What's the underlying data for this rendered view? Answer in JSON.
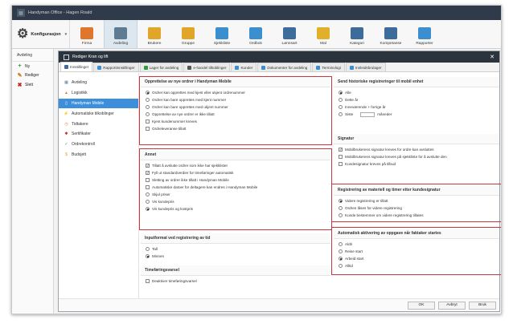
{
  "window": {
    "title": "Handyman Office - Hagen Roald"
  },
  "ribbon": {
    "section_label": "Konfigurasjon",
    "buttons": [
      {
        "label": "Firma",
        "color": "#e0752c",
        "icon": "home-icon"
      },
      {
        "label": "Avdeling",
        "color": "#5f7a93",
        "icon": "building-icon"
      },
      {
        "label": "Brukere",
        "color": "#e1a52a",
        "icon": "user-icon"
      },
      {
        "label": "Gruppe",
        "color": "#e1a52a",
        "icon": "group-icon"
      },
      {
        "label": "Sjekkliste",
        "color": "#3c8fcf",
        "icon": "checklist-icon"
      },
      {
        "label": "Ordbok",
        "color": "#3c8fcf",
        "icon": "book-icon"
      },
      {
        "label": "Lønnsart",
        "color": "#3d6b9a",
        "icon": "clock-icon"
      },
      {
        "label": "Mal",
        "color": "#e1b02a",
        "icon": "template-icon"
      },
      {
        "label": "Kategori",
        "color": "#3d6b9a",
        "icon": "category-icon"
      },
      {
        "label": "Kompetanse",
        "color": "#3d6b9a",
        "icon": "competence-icon"
      },
      {
        "label": "Rapporter",
        "color": "#3c8fcf",
        "icon": "report-icon"
      }
    ]
  },
  "leftpanel": {
    "header": "Avdeling",
    "items": [
      {
        "label": "Ny",
        "glyph": "+",
        "color": "#2e9c3a"
      },
      {
        "label": "Rediger",
        "glyph": "✎",
        "color": "#c8780c"
      },
      {
        "label": "Slett",
        "glyph": "✖",
        "color": "#cc2020"
      }
    ]
  },
  "dialog": {
    "title": "Rediger Kran og lift",
    "tabs": [
      {
        "label": "Innstillinger",
        "color": "#3d6b9a"
      },
      {
        "label": "Rapportinnstillinger",
        "color": "#3c8fcf"
      },
      {
        "label": "Lager for avdeling",
        "color": "#2e9c3a"
      },
      {
        "label": "e-handel tilkoblinger",
        "color": "#555555"
      },
      {
        "label": "Kunder",
        "color": "#3c8fcf"
      },
      {
        "label": "Dokumenter for avdeling",
        "color": "#3c8fcf"
      },
      {
        "label": "Terminologi",
        "color": "#3c8fcf"
      },
      {
        "label": "Innleidsbrulager",
        "color": "#3c8fcf"
      }
    ],
    "nav": [
      {
        "label": "Avdeling",
        "color": "#5f7a93",
        "glyph": "▦"
      },
      {
        "label": "Logistikk",
        "color": "#e0752c",
        "glyph": "▲"
      },
      {
        "label": "Handyman Mobile",
        "color": "#ffffff",
        "glyph": "▯"
      },
      {
        "label": "Automatiske tilkoblinger",
        "color": "#3c8fcf",
        "glyph": "⚡"
      },
      {
        "label": "Tidtakere",
        "color": "#e0752c",
        "glyph": "◷"
      },
      {
        "label": "Sertifikater",
        "color": "#cc2020",
        "glyph": "✱"
      },
      {
        "label": "Ordrekontroll",
        "color": "#2e9c3a",
        "glyph": "✓"
      },
      {
        "label": "Budsjett",
        "color": "#e1a52a",
        "glyph": "$"
      }
    ],
    "sections": {
      "opprettelse": {
        "header": "Opprettelse av nye ordrer i Handyman Mobile",
        "options": [
          {
            "type": "radio",
            "checked": true,
            "label": "Ordrer kan opprettes med kjent eller ukjent ordrenummer"
          },
          {
            "type": "radio",
            "checked": false,
            "label": "Ordrer kan bare opprettes med kjent nummer"
          },
          {
            "type": "radio",
            "checked": false,
            "label": "Ordrer kan bare opprettes med ukjent nummer"
          },
          {
            "type": "radio",
            "checked": false,
            "label": "Opprettelse av nye ordrer er ikke tillatt"
          },
          {
            "type": "check",
            "checked": false,
            "label": "Kjent kundenummer kreves"
          },
          {
            "type": "check",
            "checked": false,
            "label": "Ordreleveranse tillatt"
          }
        ]
      },
      "annet": {
        "header": "Annet",
        "options": [
          {
            "type": "check",
            "checked": true,
            "label": "Tillatt å avslutte ordrer som ikke har sjekklister"
          },
          {
            "type": "check",
            "checked": true,
            "label": "Fyll ut standardverdier for timeføringer automatisk"
          },
          {
            "type": "check",
            "checked": false,
            "label": "Sletting av ordrer ikke tillatt i Handyman Mobile"
          },
          {
            "type": "check",
            "checked": false,
            "label": "Automatiske datoer for deltagere kan endres i Handyman Mobile"
          },
          {
            "type": "radio",
            "checked": false,
            "label": "Skjul priser"
          },
          {
            "type": "radio",
            "checked": false,
            "label": "Vis kundepris"
          },
          {
            "type": "radio",
            "checked": true,
            "label": "Vis kundepris og kostpris"
          }
        ]
      },
      "inputformat": {
        "header": "Inputformat ved registrering av tid",
        "options": [
          {
            "type": "radio",
            "checked": false,
            "label": "Tall"
          },
          {
            "type": "radio",
            "checked": true,
            "label": "Minnen"
          }
        ]
      },
      "timeforing": {
        "header": "Timeføringsvarsel",
        "options": [
          {
            "type": "check",
            "checked": false,
            "label": "Deaktiver timeføringsvarsel"
          }
        ]
      },
      "historiske": {
        "header": "Send historiske registreringer til mobil enhet",
        "options": [
          {
            "type": "radio",
            "checked": true,
            "label": "Alle"
          },
          {
            "type": "radio",
            "checked": false,
            "label": "Dette år"
          },
          {
            "type": "radio",
            "checked": false,
            "label": "Inneværende + forrige år"
          },
          {
            "type": "radio",
            "checked": false,
            "label": "Siste",
            "suffix": "måneder"
          }
        ]
      },
      "signatur": {
        "header": "Signatur",
        "options": [
          {
            "type": "check",
            "checked": true,
            "label": "Mobilbrukerens signatur kreves for ordre kan avsluttes"
          },
          {
            "type": "check",
            "checked": false,
            "label": "Mobilbrukerens signatur kreves på sjekkliste for å avslutte den"
          },
          {
            "type": "check",
            "checked": false,
            "label": "Kundesignatur kreves på tilbud"
          }
        ]
      },
      "registrering": {
        "header": "Registrering av materiell og timer etter kundesignatur",
        "options": [
          {
            "type": "radio",
            "checked": true,
            "label": "Videre registrering er tillatt"
          },
          {
            "type": "radio",
            "checked": false,
            "label": "Ordren låses for videre registrering"
          },
          {
            "type": "radio",
            "checked": false,
            "label": "Kunde bestemmer om videre registrering tillates"
          }
        ]
      },
      "automatisk": {
        "header": "Automatisk aktivering av oppgave når faktaker startes",
        "options": [
          {
            "type": "radio",
            "checked": false,
            "label": "Aldri"
          },
          {
            "type": "radio",
            "checked": false,
            "label": "Reise start"
          },
          {
            "type": "radio",
            "checked": true,
            "label": "Arbeid start"
          },
          {
            "type": "radio",
            "checked": false,
            "label": "Alltid"
          }
        ]
      }
    },
    "buttons": {
      "ok": "OK",
      "cancel": "Avbryt",
      "apply": "Bruk"
    }
  }
}
